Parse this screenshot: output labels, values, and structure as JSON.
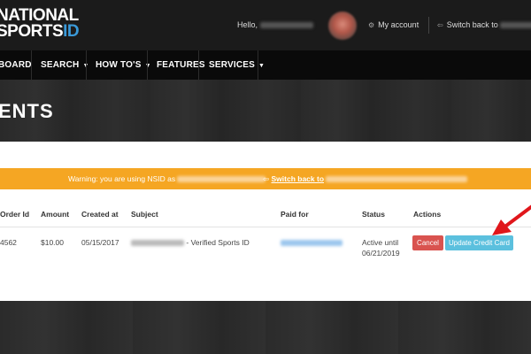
{
  "header": {
    "logo_line1": "NATIONAL",
    "logo_line2_a": "SPORTS",
    "logo_line2_b": "ID",
    "hello": "Hello,",
    "my_account": "My account",
    "switch_back": "Switch back to"
  },
  "nav": {
    "items": [
      "BOARD",
      "SEARCH",
      "HOW TO'S",
      "FEATURES",
      "SERVICES"
    ]
  },
  "page": {
    "title": "ENTS"
  },
  "warning": {
    "message": "Warning: you are using NSID as",
    "switch_back": "Switch back to"
  },
  "table": {
    "headers": [
      "Order Id",
      "Amount",
      "Created at",
      "Subject",
      "Paid for",
      "Status",
      "Actions"
    ],
    "row": {
      "order_id": "4562",
      "amount": "$10.00",
      "created_at": "05/15/2017",
      "subject_suffix": "- Verified Sports ID",
      "status_line1": "Active until",
      "status_line2": "06/21/2019"
    },
    "actions": {
      "cancel": "Cancel",
      "update_card": "Update Credit Card"
    }
  },
  "colors": {
    "warning": "#f5a623",
    "cancel": "#d9534f",
    "update": "#5bc0de",
    "arrow": "#e0161b",
    "logo_accent": "#3a9ad9"
  }
}
